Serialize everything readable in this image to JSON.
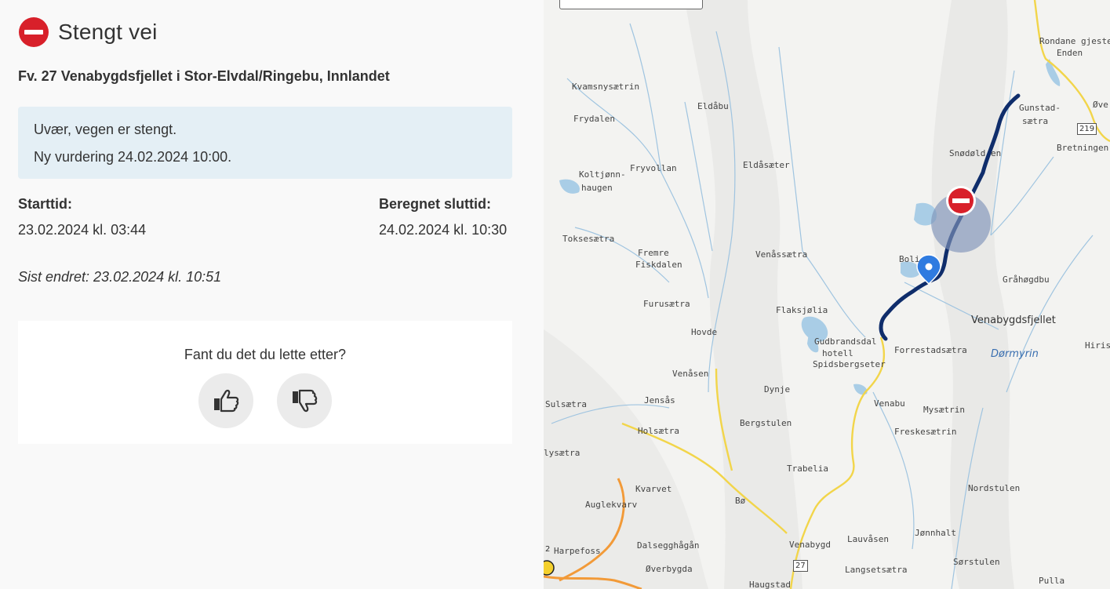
{
  "header": {
    "title": "Stengt vei",
    "icon": "no-entry-icon"
  },
  "road_name": "Fv. 27 Venabygdsfjellet i Stor-Elvdal/Ringebu, Innlandet",
  "message": {
    "line1": "Uvær, vegen er stengt.",
    "line2": "Ny vurdering 24.02.2024 10:00."
  },
  "times": {
    "start_label": "Starttid:",
    "start_value": "23.02.2024 kl. 03:44",
    "end_label": "Beregnet sluttid:",
    "end_value": "24.02.2024 kl. 10:30"
  },
  "last_changed": "Sist endret: 23.02.2024 kl. 10:51",
  "feedback": {
    "question": "Fant du det du lette etter?",
    "yes_icon": "thumbs-up-icon",
    "no_icon": "thumbs-down-icon"
  },
  "map": {
    "places": {
      "rondane": "Rondane gjeste",
      "enden": "Enden",
      "kvamsny": "Kvamsnysætrin",
      "eldabu": "Eldåbu",
      "frydalen": "Frydalen",
      "gunstad1": "Gunstad-",
      "gunstad2": "sætra",
      "ove": "Øve",
      "bretningen": "Bretningen",
      "snodold": "Snødøld  en",
      "koltjonn1": "Koltjønn-",
      "koltjonn2": "haugen",
      "fryvollan": "Fryvollan",
      "eldasaeter": "Eldåsæter",
      "toksesaetra": "Toksesætra",
      "fremre1": "Fremre",
      "fremre2": "Fiskdalen",
      "venassaetra": "Venåssætra",
      "bolia": "Boli",
      "grahogdbu": "Gråhøgdbu",
      "furusaetra": "Furusætra",
      "flaksjolia": "Flaksjølia",
      "venabygdsfjellet": "Venabygdsfjellet",
      "hovde": "Hovde",
      "gudbrandsdal1": "Gudbrandsdal",
      "gudbrandsdal2": "hotell",
      "gudbrandsdal3": "Spidsbergseter",
      "forrestad": "Forrestadsætra",
      "dormyrin": "Dørmyrin",
      "hirisj": "Hirisj",
      "venasen": "Venåsen",
      "sulsaetra": "Sulsætra",
      "jensas": "Jensås",
      "dynje": "Dynje",
      "venabu": "Venabu",
      "mysaetrin": "Mysætrin",
      "holsaetra": "Holsætra",
      "bergstulen": "Bergstulen",
      "freskesaetrin": "Freskesætrin",
      "lysaetra": "lysætra",
      "trabelia": "Trabelia",
      "kvarvet": "Kvarvet",
      "nordstulen": "Nordstulen",
      "auglekvarv": "Auglekvarv",
      "bo": "Bø",
      "jonnhalt": "Jønnhalt",
      "harpefoss": "Harpefoss",
      "dalsegghagan": "Dalsegghågån",
      "venabygd": "Venabygd",
      "lauvasen": "Lauvåsen",
      "overbygda": "Øverbygda",
      "langsetsaetra": "Langsetsætra",
      "sorstulen": "Sørstulen",
      "haugstad": "Haugstad",
      "pulla": "Pulla"
    },
    "shields": {
      "r219": "219",
      "r27": "27",
      "r2": "2"
    },
    "colors": {
      "closure_line": "#0f2d6b",
      "closure_marker": "#d8202a",
      "location_pin": "#2f7be0",
      "main_road": "#f2d54a"
    }
  }
}
